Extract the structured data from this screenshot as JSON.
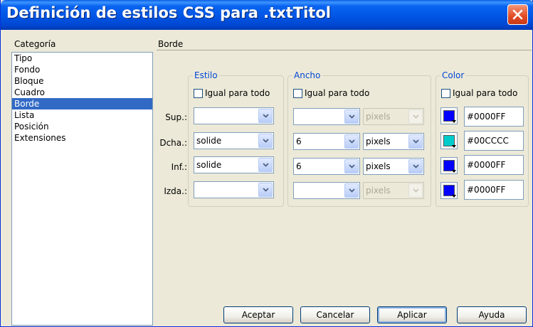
{
  "window": {
    "title": "Definición de estilos CSS para .txtTitol"
  },
  "category": {
    "label": "Categoría",
    "items": [
      "Tipo",
      "Fondo",
      "Bloque",
      "Cuadro",
      "Borde",
      "Lista",
      "Posición",
      "Extensiones"
    ],
    "selected": "Borde"
  },
  "section_title": "Borde",
  "groups": {
    "estilo": {
      "title": "Estilo",
      "same_for_all": "Igual para todo"
    },
    "ancho": {
      "title": "Ancho",
      "same_for_all": "Igual para todo"
    },
    "color": {
      "title": "Color",
      "same_for_all": "Igual para todo"
    }
  },
  "rows": [
    {
      "label": "Sup.:",
      "style": "",
      "width": "",
      "unit": "pixels",
      "unit_enabled": false,
      "color": "#0000FF",
      "swatch": "#0000ff"
    },
    {
      "label": "Dcha.:",
      "style": "solide",
      "width": "6",
      "unit": "pixels",
      "unit_enabled": true,
      "color": "#00CCCC",
      "swatch": "#00cccc"
    },
    {
      "label": "Inf.:",
      "style": "solide",
      "width": "6",
      "unit": "pixels",
      "unit_enabled": true,
      "color": "#0000FF",
      "swatch": "#0000ff"
    },
    {
      "label": "Izda.:",
      "style": "",
      "width": "",
      "unit": "pixels",
      "unit_enabled": false,
      "color": "#0000FF",
      "swatch": "#0000ff"
    }
  ],
  "buttons": {
    "ok": "Aceptar",
    "cancel": "Cancelar",
    "apply": "Aplicar",
    "help": "Ayuda"
  },
  "icons": {
    "close": "close-icon",
    "dropdown": "chevron-down-icon"
  },
  "colors": {
    "titlebar": "#0055e5",
    "selection": "#316ac5",
    "group_title": "#0046d5"
  }
}
